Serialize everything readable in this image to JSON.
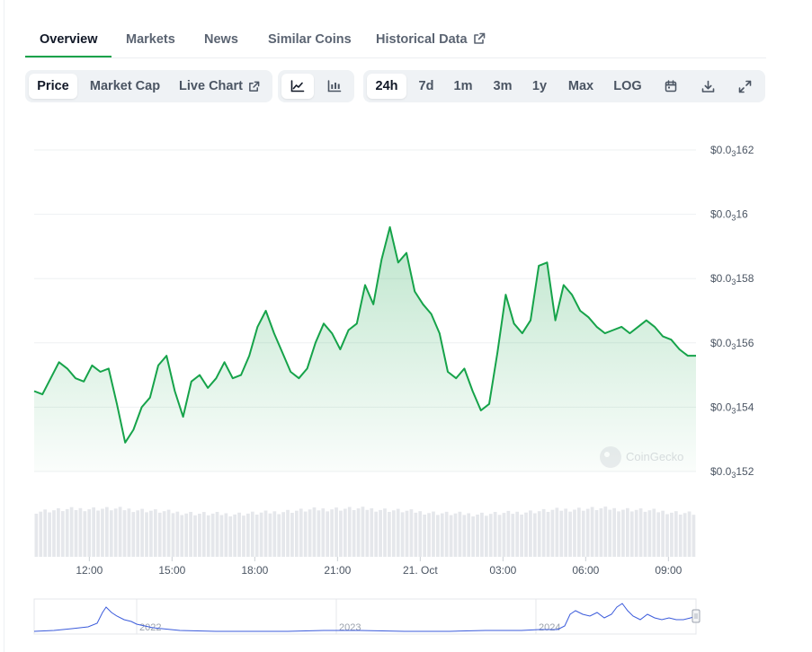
{
  "tabs": [
    {
      "label": "Overview"
    },
    {
      "label": "Markets"
    },
    {
      "label": "News"
    },
    {
      "label": "Similar Coins"
    },
    {
      "label": "Historical Data"
    }
  ],
  "toolbar": {
    "metrics": [
      "Price",
      "Market Cap",
      "Live Chart"
    ],
    "views": [
      "line-chart-icon",
      "candlestick-chart-icon"
    ],
    "ranges": [
      "24h",
      "7d",
      "1m",
      "3m",
      "1y",
      "Max",
      "LOG"
    ],
    "tools": [
      "calendar-icon",
      "download-icon",
      "fullscreen-icon"
    ]
  },
  "colors": {
    "accent": "#16a34a",
    "line": "#16a34a",
    "volume": "#e5e7eb",
    "nav_line": "#3b5bdb"
  },
  "watermark": "CoinGecko",
  "chart_data": {
    "type": "line",
    "y_axis": {
      "ticks": [
        {
          "value": 0.000162,
          "prefix": "$0.0",
          "sub": "3",
          "digits": "162"
        },
        {
          "value": 0.00016,
          "prefix": "$0.0",
          "sub": "3",
          "digits": "16"
        },
        {
          "value": 0.000158,
          "prefix": "$0.0",
          "sub": "3",
          "digits": "158"
        },
        {
          "value": 0.000156,
          "prefix": "$0.0",
          "sub": "3",
          "digits": "156"
        },
        {
          "value": 0.000154,
          "prefix": "$0.0",
          "sub": "3",
          "digits": "154"
        },
        {
          "value": 0.000152,
          "prefix": "$0.0",
          "sub": "3",
          "digits": "152"
        }
      ],
      "ylim": [
        0.000152,
        0.000162
      ]
    },
    "x_axis": {
      "ticks": [
        {
          "label": "12:00",
          "hour": 2
        },
        {
          "label": "15:00",
          "hour": 5
        },
        {
          "label": "18:00",
          "hour": 8
        },
        {
          "label": "21:00",
          "hour": 11
        },
        {
          "label": "21. Oct",
          "hour": 14
        },
        {
          "label": "03:00",
          "hour": 17
        },
        {
          "label": "06:00",
          "hour": 20
        },
        {
          "label": "09:00",
          "hour": 23
        }
      ],
      "xlim": [
        0,
        24
      ]
    },
    "series": [
      {
        "hours": [
          0,
          0.3,
          0.6,
          0.9,
          1.2,
          1.5,
          1.8,
          2.1,
          2.4,
          2.7,
          3.0,
          3.3,
          3.6,
          3.9,
          4.2,
          4.5,
          4.8,
          5.1,
          5.4,
          5.7,
          6.0,
          6.3,
          6.6,
          6.9,
          7.2,
          7.5,
          7.8,
          8.1,
          8.4,
          8.7,
          9.0,
          9.3,
          9.6,
          9.9,
          10.2,
          10.5,
          10.8,
          11.1,
          11.4,
          11.7,
          12.0,
          12.3,
          12.6,
          12.9,
          13.2,
          13.5,
          13.8,
          14.1,
          14.4,
          14.7,
          15.0,
          15.3,
          15.6,
          15.9,
          16.2,
          16.5,
          16.8,
          17.1,
          17.4,
          17.7,
          18.0,
          18.3,
          18.6,
          18.9,
          19.2,
          19.5,
          19.8,
          20.1,
          20.4,
          20.7,
          21.0,
          21.3,
          21.6,
          21.9,
          22.2,
          22.5,
          22.8,
          23.1,
          23.4,
          23.7,
          24.0
        ],
        "values": [
          0.0001545,
          0.0001544,
          0.0001549,
          0.0001554,
          0.0001552,
          0.0001549,
          0.0001548,
          0.0001553,
          0.0001551,
          0.0001552,
          0.0001541,
          0.0001529,
          0.0001533,
          0.000154,
          0.0001543,
          0.0001553,
          0.0001556,
          0.0001545,
          0.0001537,
          0.0001548,
          0.000155,
          0.0001546,
          0.0001549,
          0.0001554,
          0.0001549,
          0.000155,
          0.0001556,
          0.0001565,
          0.000157,
          0.0001563,
          0.0001557,
          0.0001551,
          0.0001549,
          0.0001552,
          0.000156,
          0.0001566,
          0.0001563,
          0.0001558,
          0.0001564,
          0.0001566,
          0.0001578,
          0.0001572,
          0.0001586,
          0.0001596,
          0.0001585,
          0.0001588,
          0.0001576,
          0.0001572,
          0.0001569,
          0.0001563,
          0.0001551,
          0.0001549,
          0.0001552,
          0.0001545,
          0.0001539,
          0.0001541,
          0.0001557,
          0.0001575,
          0.0001566,
          0.0001563,
          0.0001567,
          0.0001584,
          0.0001585,
          0.0001567,
          0.0001578,
          0.0001575,
          0.000157,
          0.0001568,
          0.0001565,
          0.0001563,
          0.0001564,
          0.0001565,
          0.0001563,
          0.0001565,
          0.0001567,
          0.0001565,
          0.0001562,
          0.0001561,
          0.0001558,
          0.0001556,
          0.0001556
        ]
      }
    ],
    "volume_bar_count": 150,
    "navigator": {
      "labels": [
        "2022",
        "2023",
        "2024"
      ]
    }
  }
}
